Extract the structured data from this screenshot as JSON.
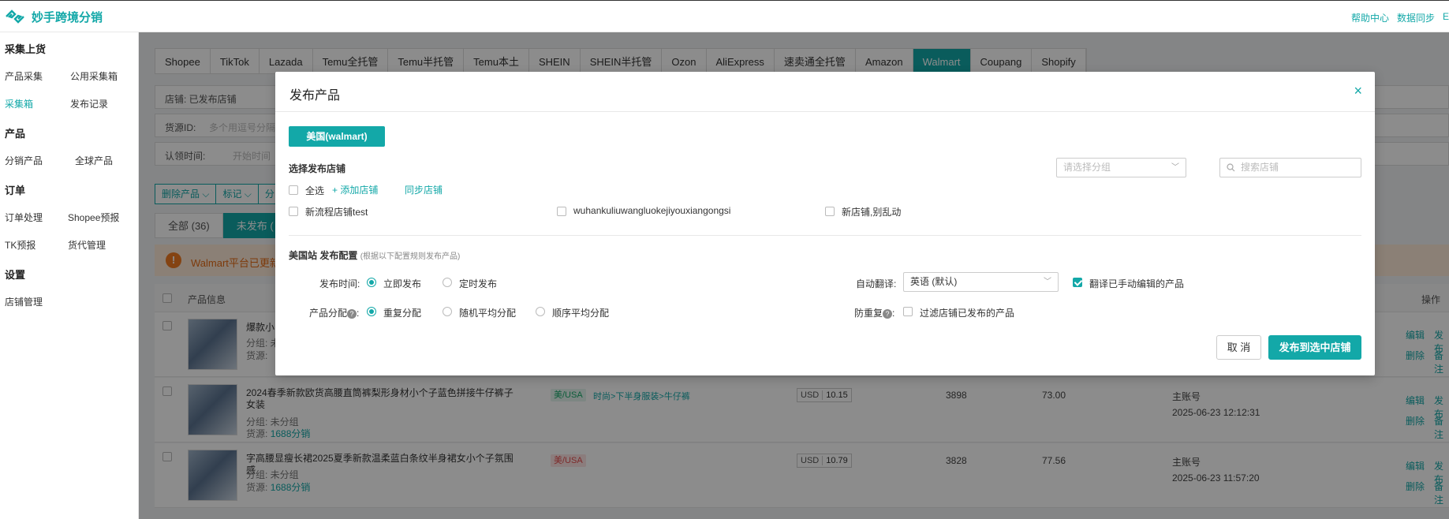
{
  "header": {
    "app_name": "妙手跨境分销",
    "links": [
      "帮助中心",
      "数据同步",
      "E"
    ]
  },
  "sidebar": {
    "sections": [
      {
        "title": "采集上货",
        "items": [
          "产品采集",
          "公用采集箱",
          "采集箱",
          "发布记录"
        ]
      },
      {
        "title": "产品",
        "items": [
          "分销产品",
          "全球产品"
        ]
      },
      {
        "title": "订单",
        "items": [
          "订单处理",
          "Shopee预报",
          "TK预报",
          "货代管理"
        ]
      },
      {
        "title": "设置",
        "items": [
          "店铺管理"
        ]
      }
    ],
    "active_item": "采集箱"
  },
  "platform_tabs": [
    "Shopee",
    "TikTok",
    "Lazada",
    "Temu全托管",
    "Temu半托管",
    "Temu本土",
    "SHEIN",
    "SHEIN半托管",
    "Ozon",
    "AliExpress",
    "速卖通全托管",
    "Amazon",
    "Walmart",
    "Coupang",
    "Shopify"
  ],
  "active_platform": "Walmart",
  "filters": {
    "store_label": "店铺: 已发布店铺",
    "source_label": "货源ID:",
    "source_placeholder": "多个用逗号分隔",
    "claim_label": "认领时间:",
    "claim_placeholder": "开始时间"
  },
  "toolbar": {
    "delete": "删除产品 ⌵",
    "mark": "标记 ⌵",
    "more": "分"
  },
  "status_tabs": [
    "全部 (36)",
    "未发布 ("
  ],
  "notice": {
    "icon": "!",
    "text": "Walmart平台已更新"
  },
  "table": {
    "header_product": "产品信息",
    "header_ops": "操作",
    "rows": [
      {
        "title": "爆款小",
        "group": "分组: 未",
        "source": "货源:",
        "ops": [
          "编辑",
          "发布",
          "删除",
          "备注"
        ]
      },
      {
        "title": "2024春季新款欧货高腰直筒裤梨形身材小个子蓝色拼接牛仔裤子女装",
        "group": "分组: 未分组",
        "source_prefix": "货源:",
        "source": "1688分销",
        "tag": "美/USA",
        "category": "时尚>下半身服装>牛仔裤",
        "currency": "USD",
        "price": "10.15",
        "stock": "3898",
        "amount": "73.00",
        "account": "主账号",
        "time": "2025-06-23 12:12:31",
        "ops": [
          "编辑",
          "发布",
          "删除",
          "备注"
        ]
      },
      {
        "title": "字高腰显瘦长裙2025夏季新款温柔蓝白条纹半身裙女小个子氛围感",
        "group": "分组: 未分组",
        "source_prefix": "货源:",
        "source": "1688分销",
        "tag": "美/USA",
        "currency": "USD",
        "price": "10.79",
        "stock": "3828",
        "amount": "77.56",
        "account": "主账号",
        "time": "2025-06-23 11:57:20",
        "ops": [
          "编辑",
          "发布",
          "删除",
          "备注"
        ]
      }
    ]
  },
  "modal": {
    "title": "发布产品",
    "close": "×",
    "country_button": "美国(walmart)",
    "select_store_label": "选择发布店铺",
    "group_placeholder": "请选择分组",
    "store_search_placeholder": "搜索店铺",
    "select_all": "全选",
    "add_store": "+ 添加店铺",
    "sync_store": "同步店铺",
    "stores": [
      "新流程店铺test",
      "wuhankuliuwangluokejiyouxiangongsi",
      "新店铺,别乱动"
    ],
    "config_title": "美国站 发布配置",
    "config_hint": "(根据以下配置规则发布产品)",
    "publish_time_label": "发布时间:",
    "publish_now": "立即发布",
    "publish_scheduled": "定时发布",
    "auto_translate_label": "自动翻译:",
    "translate_value": "英语 (默认)",
    "translate_edited": "翻译已手动编辑的产品",
    "distribution_label": "产品分配",
    "dist_repeat": "重复分配",
    "dist_random": "随机平均分配",
    "dist_order": "顺序平均分配",
    "dedupe_label": "防重复",
    "dedupe_option": "过滤店铺已发布的产品",
    "help_mark": "?",
    "cancel": "取 消",
    "publish": "发布到选中店铺"
  },
  "colors": {
    "accent": "#13a8a8",
    "notice_bg": "#fde9d8",
    "notice_text": "#e46b14"
  }
}
